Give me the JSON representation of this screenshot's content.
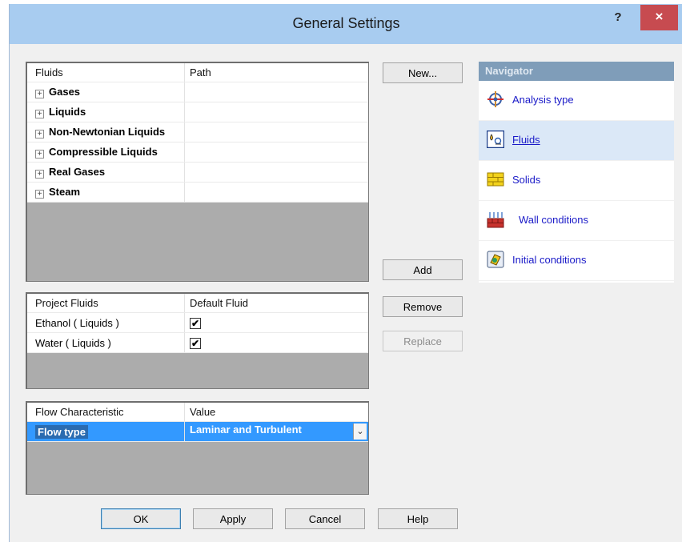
{
  "window": {
    "title": "General Settings",
    "help": "?",
    "close": "×"
  },
  "fluids_table": {
    "headers": [
      "Fluids",
      "Path"
    ],
    "rows": [
      "Gases",
      "Liquids",
      "Non-Newtonian Liquids",
      "Compressible Liquids",
      "Real Gases",
      "Steam"
    ],
    "expander": "+"
  },
  "project_table": {
    "headers": [
      "Project Fluids",
      "Default Fluid"
    ],
    "rows": [
      {
        "name": "Ethanol ( Liquids )",
        "default": "✔"
      },
      {
        "name": "Water ( Liquids )",
        "default": "✔"
      }
    ]
  },
  "flow_table": {
    "headers": [
      "Flow Characteristic",
      "Value"
    ],
    "row": {
      "name": "Flow type",
      "value": "Laminar and Turbulent"
    },
    "dropdown_glyph": "⌄"
  },
  "buttons": {
    "new": "New...",
    "add": "Add",
    "remove": "Remove",
    "replace": "Replace",
    "ok": "OK",
    "apply": "Apply",
    "cancel": "Cancel",
    "help": "Help"
  },
  "navigator": {
    "header": "Navigator",
    "items": [
      {
        "label": "Analysis type",
        "icon": "analysis-type-icon"
      },
      {
        "label": "Fluids",
        "icon": "fluids-icon",
        "active": true
      },
      {
        "label": "Solids",
        "icon": "solids-icon"
      },
      {
        "label": "Wall conditions",
        "icon": "wall-conditions-icon"
      },
      {
        "label": "Initial conditions",
        "icon": "initial-conditions-icon"
      }
    ]
  }
}
